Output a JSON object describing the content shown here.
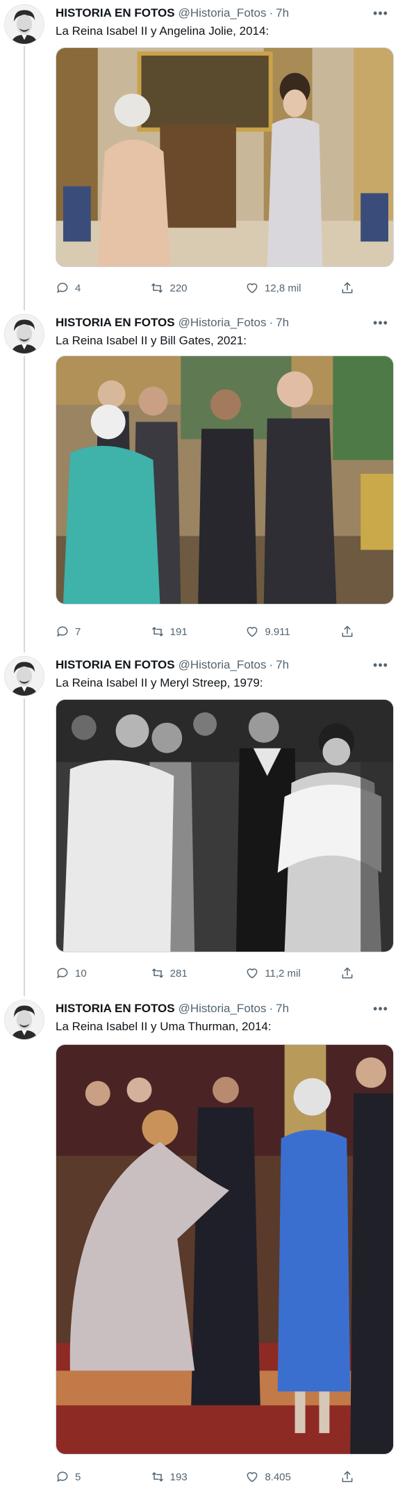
{
  "tweets": [
    {
      "name": "HISTORIA EN FOTOS",
      "handle": "@Historia_Fotos",
      "time": "7h",
      "text": "La Reina Isabel II y Angelina Jolie, 2014:",
      "replies": "4",
      "retweets": "220",
      "likes": "12,8 mil"
    },
    {
      "name": "HISTORIA EN FOTOS",
      "handle": "@Historia_Fotos",
      "time": "7h",
      "text": "La Reina Isabel II y Bill Gates, 2021:",
      "replies": "7",
      "retweets": "191",
      "likes": "9.911"
    },
    {
      "name": "HISTORIA EN FOTOS",
      "handle": "@Historia_Fotos",
      "time": "7h",
      "text": "La Reina Isabel II y Meryl Streep, 1979:",
      "replies": "10",
      "retweets": "281",
      "likes": "11,2 mil"
    },
    {
      "name": "HISTORIA EN FOTOS",
      "handle": "@Historia_Fotos",
      "time": "7h",
      "text": "La Reina Isabel II y Uma Thurman, 2014:",
      "replies": "5",
      "retweets": "193",
      "likes": "8.405"
    }
  ],
  "icons": {
    "separator": "·",
    "more": "•••"
  },
  "colors": {
    "text_primary": "#0f1419",
    "text_secondary": "#536471",
    "thread_line": "#cfd9de"
  }
}
